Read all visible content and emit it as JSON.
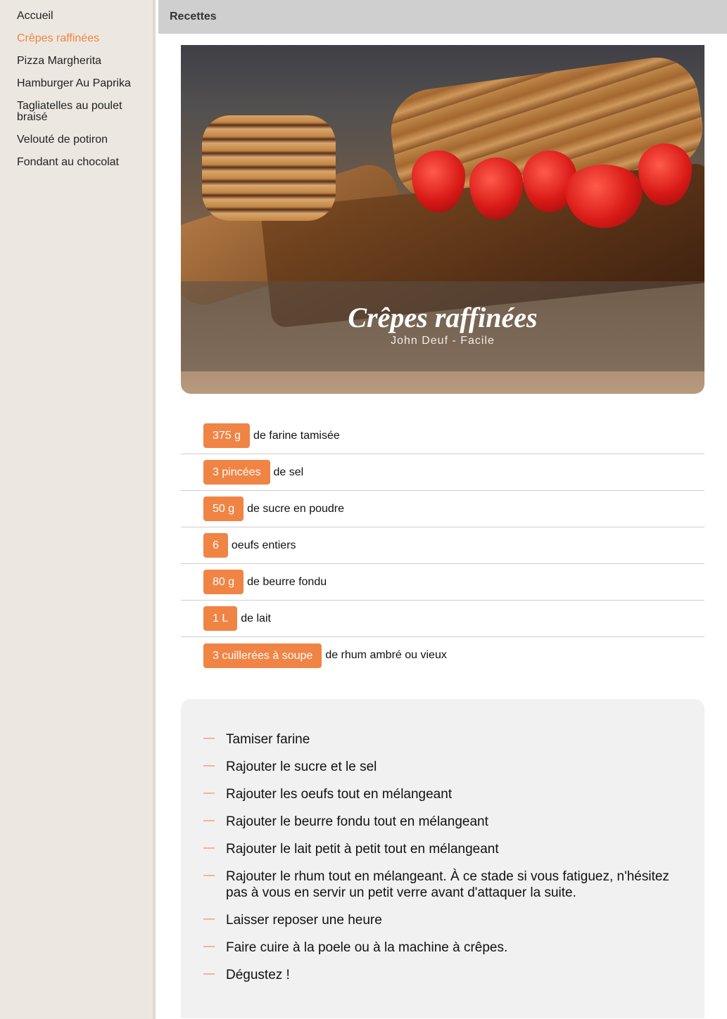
{
  "sidebar": {
    "items": [
      {
        "label": "Accueil",
        "active": false
      },
      {
        "label": "Crêpes raffinées",
        "active": true
      },
      {
        "label": "Pizza Margherita",
        "active": false
      },
      {
        "label": "Hamburger Au Paprika",
        "active": false
      },
      {
        "label": "Tagliatelles au poulet braisé",
        "active": false
      },
      {
        "label": "Velouté de potiron",
        "active": false
      },
      {
        "label": "Fondant au chocolat",
        "active": false
      }
    ]
  },
  "header": {
    "title": "Recettes"
  },
  "recipe": {
    "title": "Crêpes raffinées",
    "meta": "John Deuf - Facile",
    "ingredients": [
      {
        "qty": "375 g",
        "name": "de farine tamisée"
      },
      {
        "qty": "3 pincées",
        "name": "de sel"
      },
      {
        "qty": "50 g",
        "name": "de sucre en poudre"
      },
      {
        "qty": "6",
        "name": "oeufs entiers"
      },
      {
        "qty": "80 g",
        "name": "de beurre fondu"
      },
      {
        "qty": "1 L",
        "name": "de lait"
      },
      {
        "qty": "3 cuillerées à soupe",
        "name": "de rhum ambré ou vieux"
      }
    ],
    "step_marker": "—",
    "steps": [
      "Tamiser farine",
      "Rajouter le sucre et le sel",
      "Rajouter les oeufs tout en mélangeant",
      "Rajouter le beurre fondu tout en mélangeant",
      "Rajouter le lait petit à petit tout en mélangeant",
      "Rajouter le rhum tout en mélangeant. À ce stade si vous fatiguez, n'hésitez pas à vous en servir un petit verre avant d'attaquer la suite.",
      "Laisser reposer une heure",
      "Faire cuire à la poele ou à la machine à crêpes.",
      "Dégustez !"
    ]
  },
  "colors": {
    "accent": "#f08445",
    "sidebar_bg": "#ece8e1",
    "topbar_bg": "#cfcfcf",
    "steps_bg": "#f1f1f1"
  }
}
